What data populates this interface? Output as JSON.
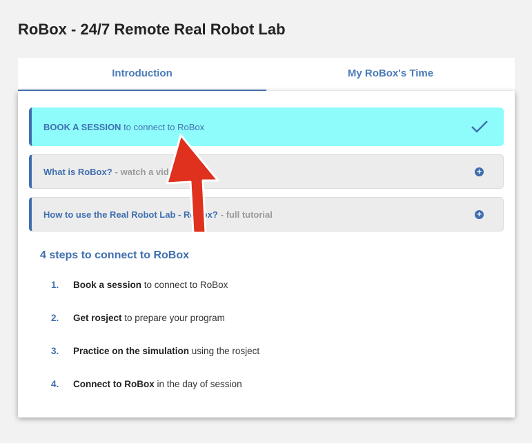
{
  "page": {
    "title": "RoBox - 24/7 Remote Real Robot Lab"
  },
  "tabs": [
    {
      "label": "Introduction",
      "active": true
    },
    {
      "label": "My RoBox's Time",
      "active": false
    }
  ],
  "accordion": {
    "active": {
      "strong": "BOOK A SESSION",
      "rest": " to connect to RoBox",
      "icon": "check-icon"
    },
    "items": [
      {
        "title": "What is RoBox?",
        "subtitle": "- watch a video",
        "icon": "plus-circle-icon"
      },
      {
        "title": "How to use the Real Robot Lab - RoBox?",
        "subtitle": "- full tutorial",
        "icon": "plus-circle-icon"
      }
    ]
  },
  "steps_section": {
    "title": "4 steps to connect to RoBox",
    "steps": [
      {
        "number": "1.",
        "strong": "Book a session",
        "rest": " to connect to RoBox"
      },
      {
        "number": "2.",
        "strong": "Get rosject",
        "rest": " to prepare your program"
      },
      {
        "number": "3.",
        "strong": "Practice on the simulation",
        "rest": " using the rosject"
      },
      {
        "number": "4.",
        "strong": "Connect to RoBox",
        "rest": " in the day of session"
      }
    ]
  },
  "colors": {
    "accent": "#3f6fb0",
    "active_panel": "#8ffcfc",
    "arrow": "#e0301e"
  }
}
